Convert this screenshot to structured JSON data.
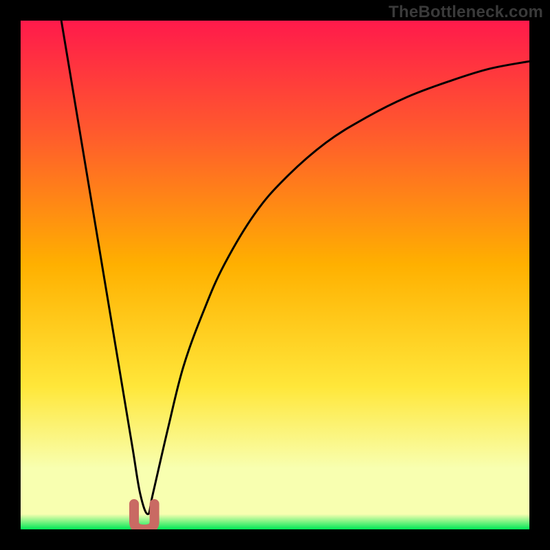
{
  "watermark": "TheBottleneck.com",
  "colors": {
    "frame": "#000000",
    "gradient_top": "#ff1a4b",
    "gradient_upper_mid": "#ff5a2d",
    "gradient_mid": "#ffb000",
    "gradient_lower_mid": "#ffe73a",
    "gradient_pale_band": "#f8ffb0",
    "gradient_bottom": "#00e756",
    "curve": "#000000",
    "marker": "#c96a63"
  },
  "chart_data": {
    "type": "line",
    "title": "",
    "xlabel": "",
    "ylabel": "",
    "xlim": [
      0,
      100
    ],
    "ylim": [
      0,
      100
    ],
    "grid": false,
    "legend": false,
    "series": [
      {
        "name": "bottleneck-curve",
        "x": [
          8,
          10,
          12,
          14,
          16,
          18,
          20,
          22,
          23.5,
          25,
          26,
          29,
          32,
          36,
          40,
          46,
          52,
          60,
          68,
          76,
          84,
          92,
          100
        ],
        "y": [
          100,
          88,
          76,
          64,
          52,
          40,
          28,
          16,
          7,
          3,
          7,
          20,
          32,
          43,
          52,
          62,
          69,
          76,
          81,
          85,
          88,
          90.5,
          92
        ]
      }
    ],
    "annotations": [
      {
        "name": "sweet-spot-marker",
        "shape": "u",
        "x_center": 24.3,
        "y_center": 2.5,
        "width": 4.0,
        "height": 5.0,
        "color": "#c96a63"
      }
    ]
  }
}
